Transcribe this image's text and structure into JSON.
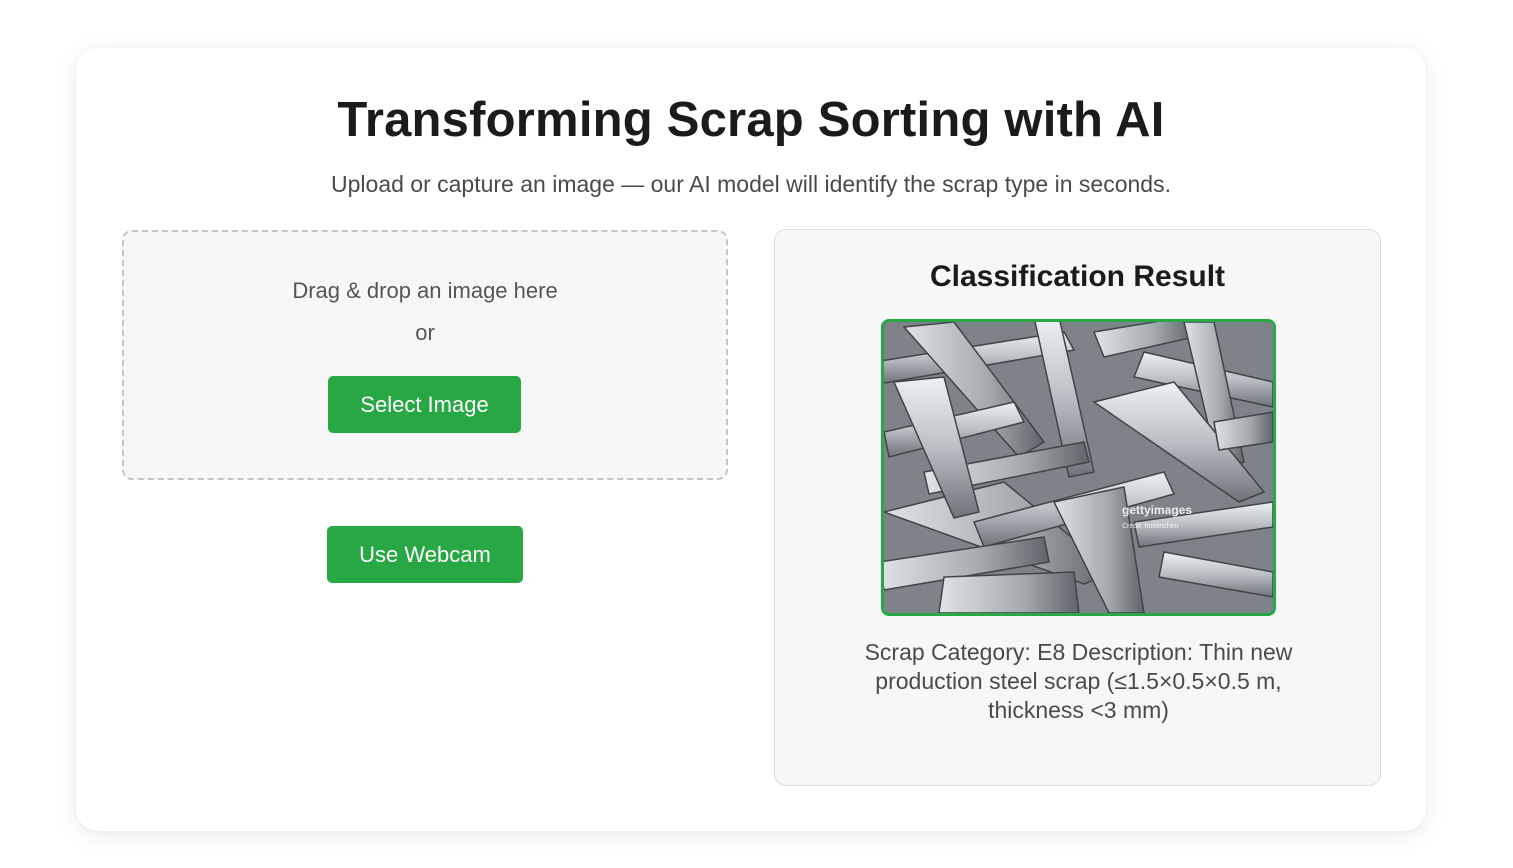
{
  "header": {
    "title": "Transforming Scrap Sorting with AI",
    "subtitle": "Upload or capture an image — our AI model will identify the scrap type in seconds."
  },
  "upload": {
    "drop_text": "Drag & drop an image here",
    "or_text": "or",
    "select_label": "Select Image"
  },
  "webcam": {
    "label": "Use Webcam"
  },
  "result": {
    "title": "Classification Result",
    "image_watermark": "gettyimages",
    "image_credit": "Credit: fotolinchen",
    "text": "Scrap Category: E8 Description: Thin new production steel scrap (≤1.5×0.5×0.5 m, thickness <3 mm)"
  },
  "colors": {
    "accent": "#28a745",
    "panel_bg": "#f7f7f7",
    "text_dark": "#1b1b1b",
    "text_muted": "#4a4a4a"
  }
}
